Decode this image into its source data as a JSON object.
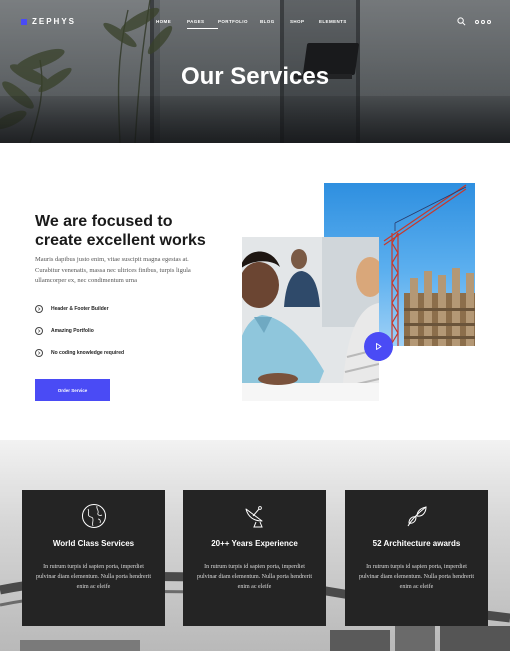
{
  "brand": {
    "name": "ZEPHYS",
    "accent_color": "#4a4bf5"
  },
  "nav": {
    "items": [
      {
        "label": "HOME",
        "active": false
      },
      {
        "label": "PAGES",
        "active": true
      },
      {
        "label": "PORTFOLIO",
        "active": false
      },
      {
        "label": "BLOG",
        "active": false
      },
      {
        "label": "SHOP",
        "active": false
      },
      {
        "label": "ELEMENTS",
        "active": false
      }
    ],
    "search_icon": "search-icon",
    "more_icon": "more-dots-icon"
  },
  "hero": {
    "title": "Our Services"
  },
  "focus": {
    "title_line1": "We are focused to",
    "title_line2": "create excellent works",
    "text": "Mauris dapibus justo enim, vitae suscipit magna egestas at. Curabitur venenatis, massa nec ultrices finibus, turpis ligula ullamcorper ex, nec condimentum urna",
    "features": [
      {
        "label": "Header & Footer Builder"
      },
      {
        "label": "Amazing Portfolio"
      },
      {
        "label": "No coding knowledge required"
      }
    ],
    "button_label": "Order Service",
    "play_icon": "play-icon"
  },
  "services": [
    {
      "icon": "globe-icon",
      "title": "World Class Services",
      "text": "In rutrum turpis id sapien porta, imperdiet pulvinar diam elementum. Nulla porta hendrerit enim ac eleife"
    },
    {
      "icon": "satellite-dish-icon",
      "title": "20++ Years Experience",
      "text": "In rutrum turpis id sapien porta, imperdiet pulvinar diam elementum. Nulla porta hendrerit enim ac eleife"
    },
    {
      "icon": "leaf-icon",
      "title": "52 Architecture awards",
      "text": "In rutrum turpis id sapien porta, imperdiet pulvinar diam elementum. Nulla porta hendrerit enim ac eleife"
    }
  ]
}
